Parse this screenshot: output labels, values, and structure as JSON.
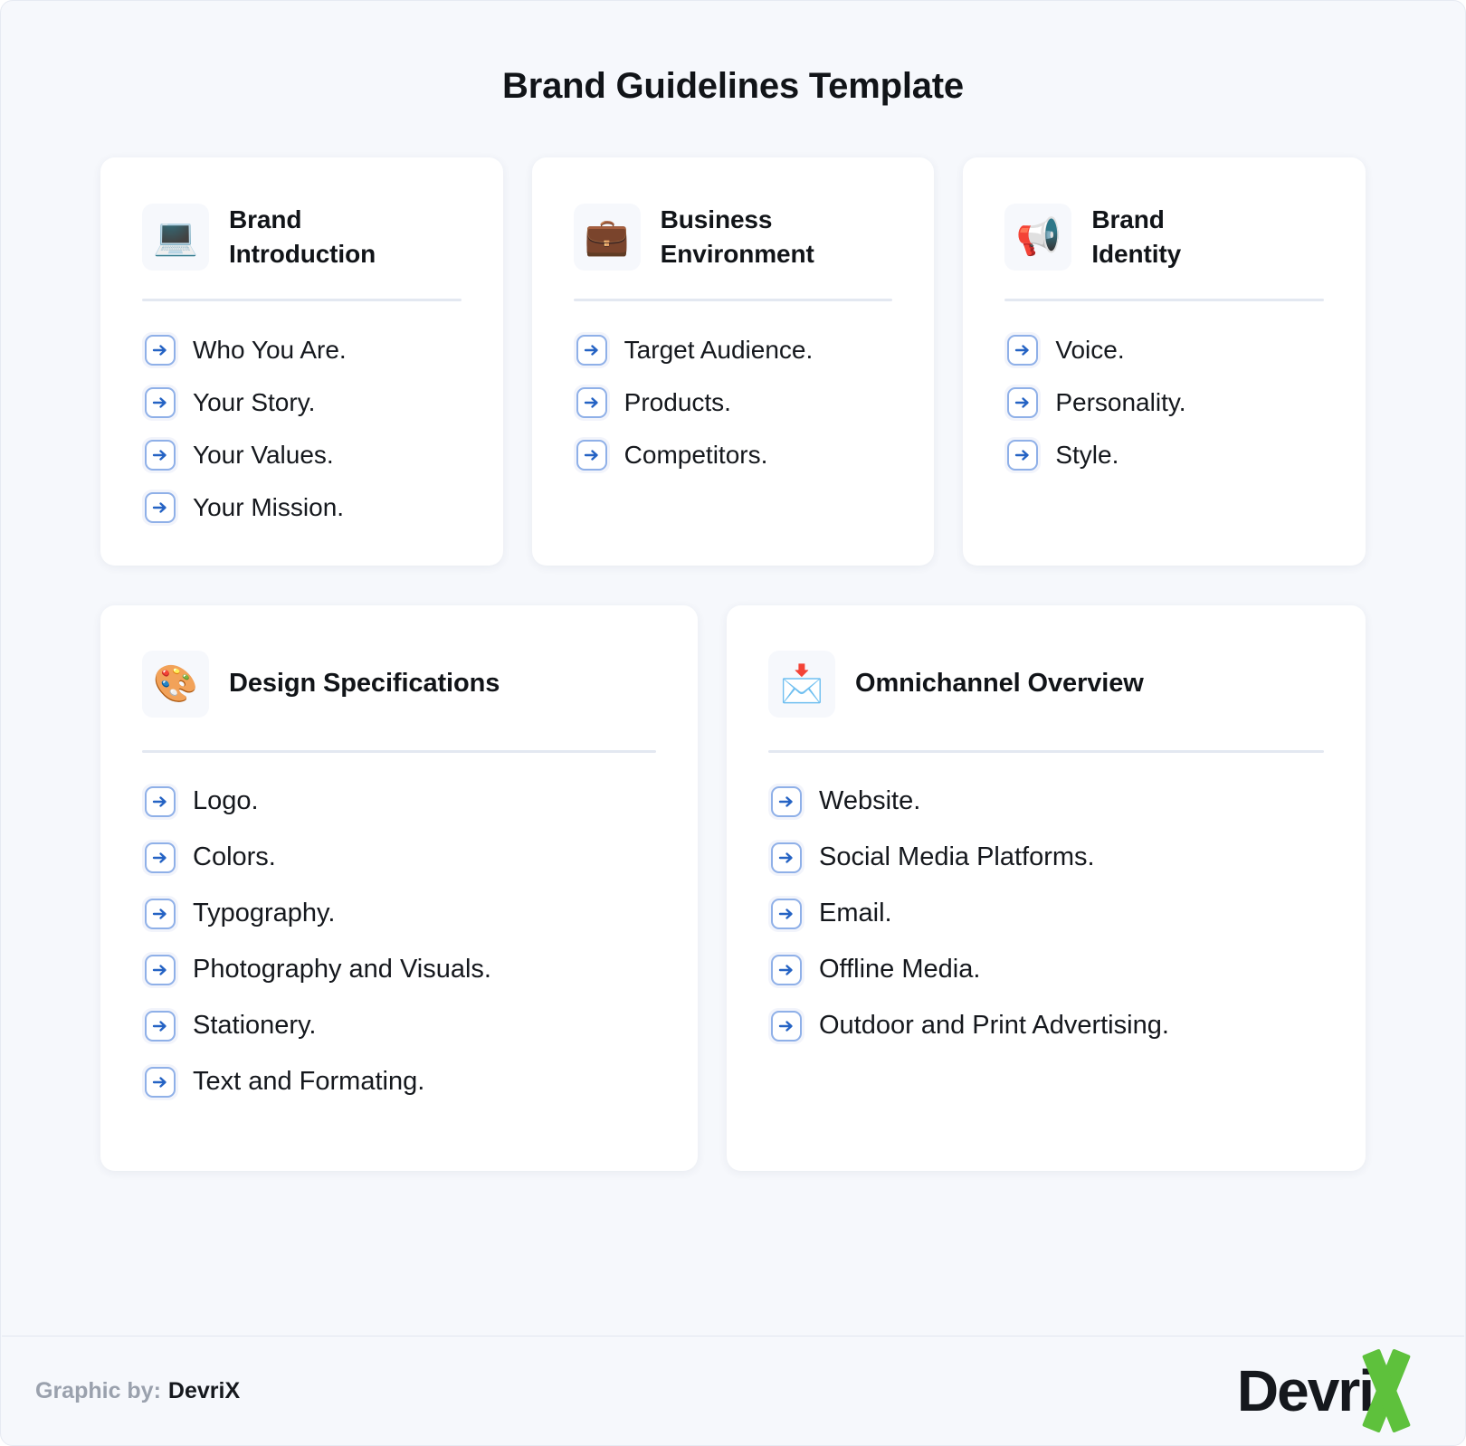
{
  "poster": {
    "title": "Brand Guidelines Template",
    "background_color": "#f6f8fc",
    "accent_color": "#2563c4",
    "arrow_border_color": "#8fb0e8"
  },
  "cards": {
    "brand_introduction": {
      "icon": "laptop-emoji",
      "icon_glyph": "💻",
      "title": "Brand Introduction",
      "title_line1": "Brand",
      "title_line2": "Introduction",
      "items": [
        "Who You Are.",
        "Your Story.",
        "Your Values.",
        "Your Mission."
      ]
    },
    "business_environment": {
      "icon": "briefcase-emoji",
      "icon_glyph": "💼",
      "title": "Business Environment",
      "title_line1": "Business",
      "title_line2": "Environment",
      "items": [
        "Target Audience.",
        "Products.",
        "Competitors."
      ]
    },
    "brand_identity": {
      "icon": "megaphone-emoji",
      "icon_glyph": "📢",
      "title": "Brand Identity",
      "title_line1": "Brand",
      "title_line2": "Identity",
      "items": [
        "Voice.",
        "Personality.",
        "Style."
      ]
    },
    "design_specifications": {
      "icon": "artist-palette-emoji",
      "icon_glyph": "🎨",
      "title": "Design Specifications",
      "items": [
        "Logo.",
        "Colors.",
        "Typography.",
        "Photography and Visuals.",
        "Stationery.",
        "Text and Formating."
      ]
    },
    "omnichannel_overview": {
      "icon": "incoming-envelope-emoji",
      "icon_glyph": "📩",
      "title": "Omnichannel Overview",
      "items": [
        "Website.",
        "Social Media Platforms.",
        "Email.",
        "Offline Media.",
        "Outdoor and Print Advertising."
      ]
    }
  },
  "footer": {
    "credit_prefix": "Graphic by:",
    "credit_name": "DevriX",
    "logo_word": "Devri",
    "logo_x": "X",
    "logo_green": "#5ec13c"
  }
}
